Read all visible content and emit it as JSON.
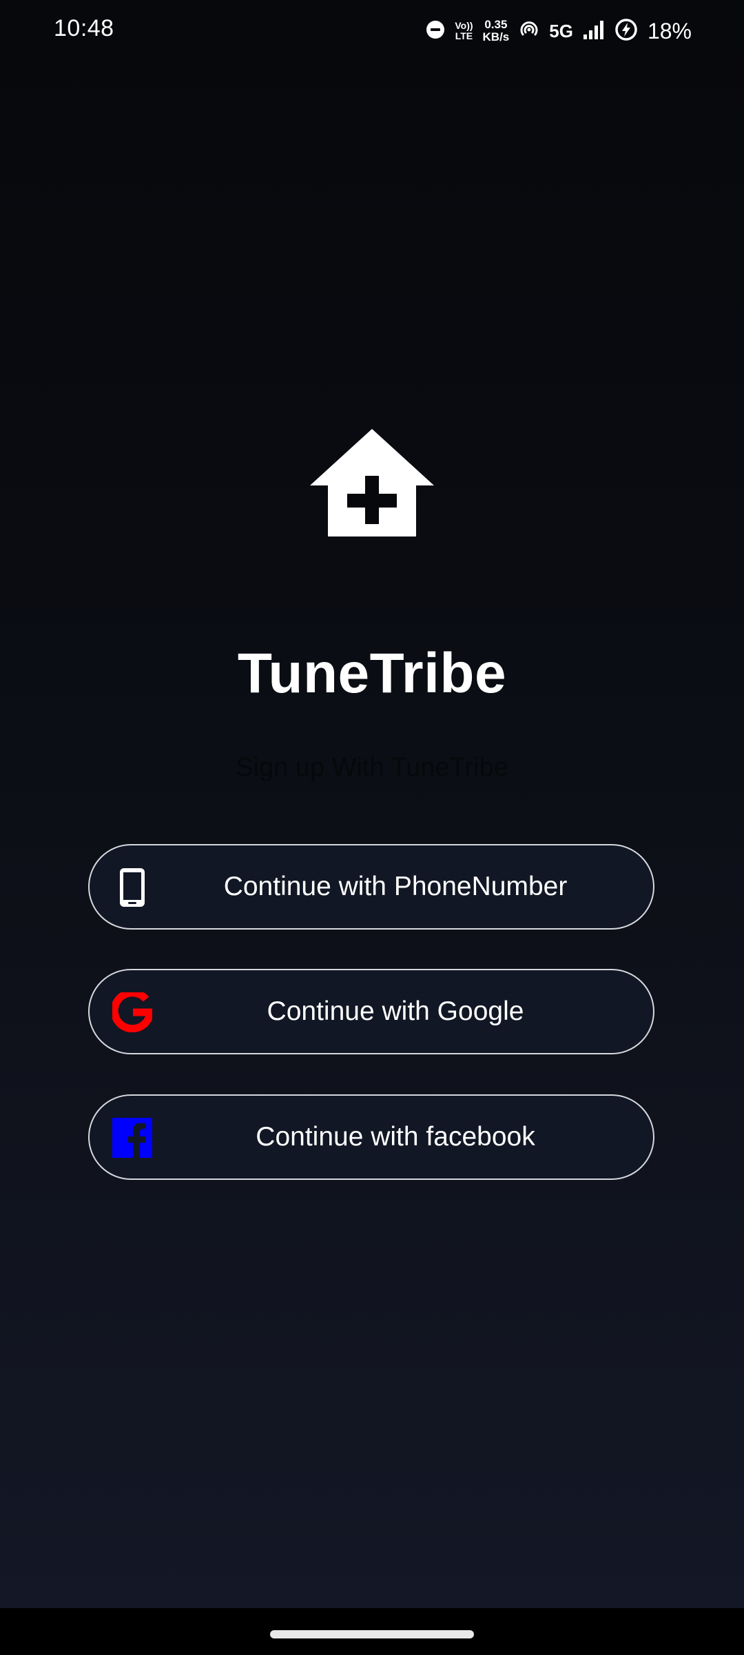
{
  "status_bar": {
    "time": "10:48",
    "volte_line1": "Vo))",
    "volte_line2": "LTE",
    "speed_value": "0.35",
    "speed_unit": "KB/s",
    "network_type": "5G",
    "battery_percent": "18%",
    "icons": [
      "do-not-disturb-icon",
      "volte-icon",
      "hotspot-icon",
      "signal-icon",
      "battery-saver-icon"
    ]
  },
  "app": {
    "logo_icon": "house-plus-icon",
    "title": "TuneTribe",
    "subtitle": "Sign up With TuneTribe"
  },
  "auth_buttons": [
    {
      "label": "Continue with PhoneNumber",
      "icon": "phone-icon"
    },
    {
      "label": "Continue with Google",
      "icon": "google-icon",
      "icon_color": "#ff0000"
    },
    {
      "label": "Continue with facebook",
      "icon": "facebook-icon",
      "icon_color": "#0000ff"
    }
  ],
  "colors": {
    "background_top": "#07080b",
    "background_bottom": "#141827",
    "button_fill": "#121725",
    "button_border": "#d6d8de"
  }
}
